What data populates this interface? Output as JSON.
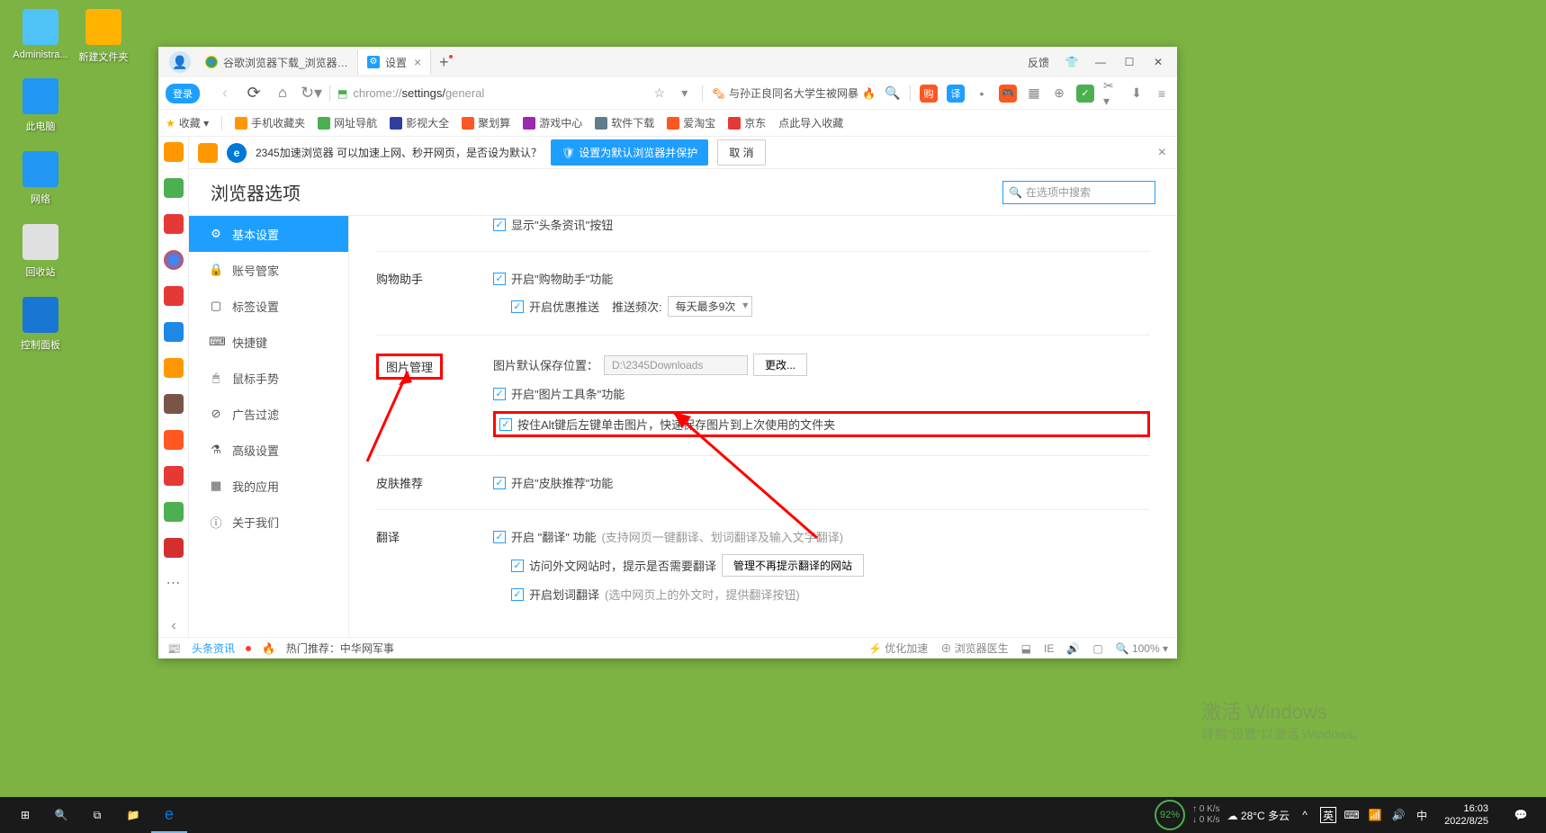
{
  "desktop": {
    "icons": [
      {
        "label": "Administra...",
        "color": "#4fc3f7"
      },
      {
        "label": "新建文件夹",
        "color": "#ffb300"
      },
      {
        "label": "此电脑",
        "color": "#2196f3"
      },
      {
        "label": "网络",
        "color": "#2196f3"
      },
      {
        "label": "回收站",
        "color": "#e0e0e0"
      },
      {
        "label": "控制面板",
        "color": "#1976d2"
      }
    ]
  },
  "browser": {
    "login_badge": "登录",
    "tabs": [
      {
        "label": "谷歌浏览器下载_浏览器官网入",
        "active": false,
        "icon": "#4285f4"
      },
      {
        "label": "设置",
        "active": true,
        "icon": "#1e9fff"
      }
    ],
    "feedback": "反馈",
    "url": {
      "scheme": "chrome://",
      "path": "settings/",
      "sub": "general"
    },
    "hot_search": "与孙正良同名大学生被网暴",
    "bookmarks": [
      {
        "label": "收藏 ▾",
        "icon": "#ffb300"
      },
      {
        "label": "手机收藏夹",
        "icon": "#ff9800"
      },
      {
        "label": "网址导航",
        "icon": "#4caf50"
      },
      {
        "label": "影视大全",
        "icon": "#303f9f"
      },
      {
        "label": "聚划算",
        "icon": "#ff5722"
      },
      {
        "label": "游戏中心",
        "icon": "#9c27b0"
      },
      {
        "label": "软件下载",
        "icon": "#607d8b"
      },
      {
        "label": "爱淘宝",
        "icon": "#ff5722"
      },
      {
        "label": "京东",
        "icon": "#e53935"
      },
      {
        "label": "点此导入收藏",
        "icon": ""
      }
    ],
    "notify": {
      "text": "2345加速浏览器 可以加速上网、秒开网页，是否设为默认？",
      "confirm": "设置为默认浏览器并保护",
      "cancel": "取 消"
    },
    "mini_sidebar": [
      {
        "color": "#ff9800"
      },
      {
        "color": "#4caf50"
      },
      {
        "color": "#e53935"
      },
      {
        "color": "#ffeb3b"
      },
      {
        "color": "#4285f4"
      },
      {
        "color": "#e53935"
      },
      {
        "color": "#1e88e5"
      },
      {
        "color": "#ff9800"
      },
      {
        "color": "#795548"
      },
      {
        "color": "#ff5722"
      },
      {
        "color": "#e53935"
      },
      {
        "color": "#4caf50"
      },
      {
        "color": "#d32f2f"
      },
      {
        "color": "#888"
      }
    ],
    "page": {
      "title": "浏览器选项",
      "search_placeholder": "在选项中搜索",
      "nav": [
        {
          "icon": "⚙",
          "label": "基本设置",
          "active": true
        },
        {
          "icon": "🔒",
          "label": "账号管家"
        },
        {
          "icon": "▢",
          "label": "标签设置"
        },
        {
          "icon": "⌨",
          "label": "快捷键"
        },
        {
          "icon": "🖱",
          "label": "鼠标手势"
        },
        {
          "icon": "⊘",
          "label": "广告过滤"
        },
        {
          "icon": "⚗",
          "label": "高级设置"
        },
        {
          "icon": "▦",
          "label": "我的应用"
        },
        {
          "icon": "ⓘ",
          "label": "关于我们"
        }
      ],
      "sections": {
        "top": {
          "chk1": "显示\"头条资讯\"按钮"
        },
        "shopping": {
          "title": "购物助手",
          "chk1": "开启\"购物助手\"功能",
          "chk2": "开启优惠推送",
          "push_label": "推送频次:",
          "push_value": "每天最多9次"
        },
        "image": {
          "title": "图片管理",
          "save_label": "图片默认保存位置：",
          "save_path": "D:\\2345Downloads",
          "change_btn": "更改...",
          "chk1": "开启\"图片工具条\"功能",
          "chk2": "按住Alt键后左键单击图片，快速保存图片到上次使用的文件夹"
        },
        "skin": {
          "title": "皮肤推荐",
          "chk1": "开启\"皮肤推荐\"功能"
        },
        "translate": {
          "title": "翻译",
          "chk1": "开启 \"翻译\" 功能",
          "hint1": "(支持网页一键翻译、划词翻译及输入文字翻译)",
          "chk2": "访问外文网站时，提示是否需要翻译",
          "btn": "管理不再提示翻译的网站",
          "chk3": "开启划词翻译",
          "hint3": "(选中网页上的外文时，提供翻译按钮)"
        }
      }
    },
    "status": {
      "news": "头条资讯",
      "hot": "热门推荐：中华网军事",
      "opt": "优化加速",
      "doctor": "浏览器医生",
      "zoom": "100%"
    }
  },
  "watermark": {
    "title": "激活 Windows",
    "sub": "转到\"设置\"以激活 Windows。"
  },
  "taskbar": {
    "weather": "28°C 多云",
    "speed": "92%",
    "net_up": "0 K/s",
    "net_down": "0 K/s",
    "ime1": "英",
    "ime2": "⌨",
    "ime3": "中",
    "time": "16:03",
    "date": "2022/8/25"
  }
}
